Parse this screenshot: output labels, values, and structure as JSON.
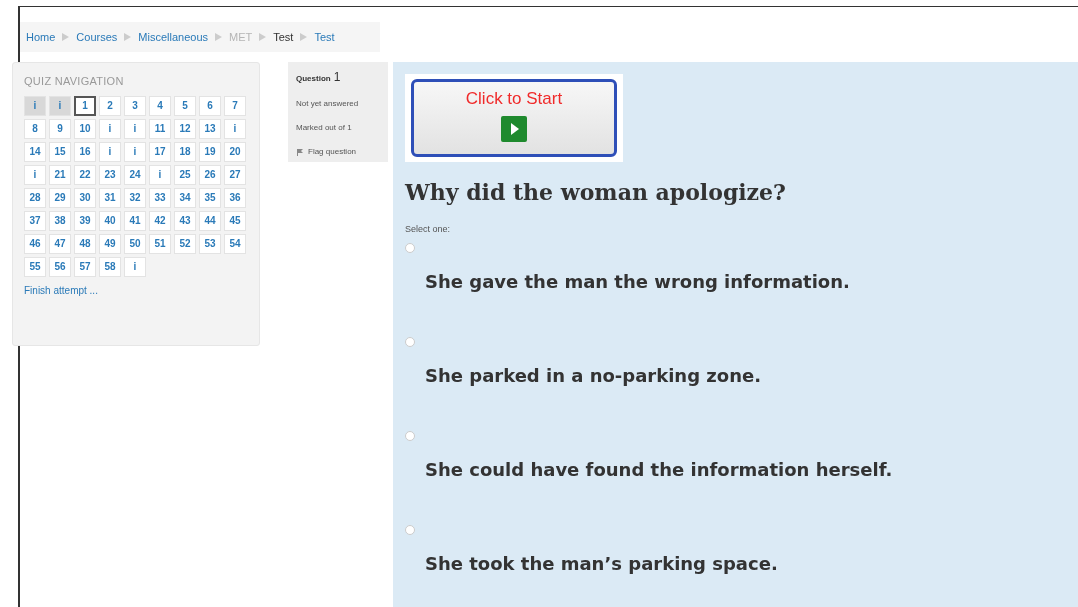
{
  "breadcrumb": [
    {
      "label": "Home",
      "kind": "link"
    },
    {
      "label": "Courses",
      "kind": "link"
    },
    {
      "label": "Miscellaneous",
      "kind": "link"
    },
    {
      "label": "MET",
      "kind": "muted"
    },
    {
      "label": "Test",
      "kind": "plain"
    },
    {
      "label": "Test",
      "kind": "link"
    }
  ],
  "quiz_navigation": {
    "title": "QUIZ NAVIGATION",
    "buttons": [
      {
        "label": "i",
        "selected": false,
        "shaded": true
      },
      {
        "label": "i",
        "selected": false,
        "shaded": true
      },
      {
        "label": "1",
        "selected": true,
        "shaded": false
      },
      {
        "label": "2",
        "selected": false,
        "shaded": false
      },
      {
        "label": "3",
        "selected": false,
        "shaded": false
      },
      {
        "label": "4",
        "selected": false,
        "shaded": false
      },
      {
        "label": "5",
        "selected": false,
        "shaded": false
      },
      {
        "label": "6",
        "selected": false,
        "shaded": false
      },
      {
        "label": "7",
        "selected": false,
        "shaded": false
      },
      {
        "label": "8",
        "selected": false,
        "shaded": false
      },
      {
        "label": "9",
        "selected": false,
        "shaded": false
      },
      {
        "label": "10",
        "selected": false,
        "shaded": false
      },
      {
        "label": "i",
        "selected": false,
        "shaded": false
      },
      {
        "label": "i",
        "selected": false,
        "shaded": false
      },
      {
        "label": "11",
        "selected": false,
        "shaded": false
      },
      {
        "label": "12",
        "selected": false,
        "shaded": false
      },
      {
        "label": "13",
        "selected": false,
        "shaded": false
      },
      {
        "label": "i",
        "selected": false,
        "shaded": false
      },
      {
        "label": "14",
        "selected": false,
        "shaded": false
      },
      {
        "label": "15",
        "selected": false,
        "shaded": false
      },
      {
        "label": "16",
        "selected": false,
        "shaded": false
      },
      {
        "label": "i",
        "selected": false,
        "shaded": false
      },
      {
        "label": "i",
        "selected": false,
        "shaded": false
      },
      {
        "label": "17",
        "selected": false,
        "shaded": false
      },
      {
        "label": "18",
        "selected": false,
        "shaded": false
      },
      {
        "label": "19",
        "selected": false,
        "shaded": false
      },
      {
        "label": "20",
        "selected": false,
        "shaded": false
      },
      {
        "label": "i",
        "selected": false,
        "shaded": false
      },
      {
        "label": "21",
        "selected": false,
        "shaded": false
      },
      {
        "label": "22",
        "selected": false,
        "shaded": false
      },
      {
        "label": "23",
        "selected": false,
        "shaded": false
      },
      {
        "label": "24",
        "selected": false,
        "shaded": false
      },
      {
        "label": "i",
        "selected": false,
        "shaded": false
      },
      {
        "label": "25",
        "selected": false,
        "shaded": false
      },
      {
        "label": "26",
        "selected": false,
        "shaded": false
      },
      {
        "label": "27",
        "selected": false,
        "shaded": false
      },
      {
        "label": "28",
        "selected": false,
        "shaded": false
      },
      {
        "label": "29",
        "selected": false,
        "shaded": false
      },
      {
        "label": "30",
        "selected": false,
        "shaded": false
      },
      {
        "label": "31",
        "selected": false,
        "shaded": false
      },
      {
        "label": "32",
        "selected": false,
        "shaded": false
      },
      {
        "label": "33",
        "selected": false,
        "shaded": false
      },
      {
        "label": "34",
        "selected": false,
        "shaded": false
      },
      {
        "label": "35",
        "selected": false,
        "shaded": false
      },
      {
        "label": "36",
        "selected": false,
        "shaded": false
      },
      {
        "label": "37",
        "selected": false,
        "shaded": false
      },
      {
        "label": "38",
        "selected": false,
        "shaded": false
      },
      {
        "label": "39",
        "selected": false,
        "shaded": false
      },
      {
        "label": "40",
        "selected": false,
        "shaded": false
      },
      {
        "label": "41",
        "selected": false,
        "shaded": false
      },
      {
        "label": "42",
        "selected": false,
        "shaded": false
      },
      {
        "label": "43",
        "selected": false,
        "shaded": false
      },
      {
        "label": "44",
        "selected": false,
        "shaded": false
      },
      {
        "label": "45",
        "selected": false,
        "shaded": false
      },
      {
        "label": "46",
        "selected": false,
        "shaded": false
      },
      {
        "label": "47",
        "selected": false,
        "shaded": false
      },
      {
        "label": "48",
        "selected": false,
        "shaded": false
      },
      {
        "label": "49",
        "selected": false,
        "shaded": false
      },
      {
        "label": "50",
        "selected": false,
        "shaded": false
      },
      {
        "label": "51",
        "selected": false,
        "shaded": false
      },
      {
        "label": "52",
        "selected": false,
        "shaded": false
      },
      {
        "label": "53",
        "selected": false,
        "shaded": false
      },
      {
        "label": "54",
        "selected": false,
        "shaded": false
      },
      {
        "label": "55",
        "selected": false,
        "shaded": false
      },
      {
        "label": "56",
        "selected": false,
        "shaded": false
      },
      {
        "label": "57",
        "selected": false,
        "shaded": false
      },
      {
        "label": "58",
        "selected": false,
        "shaded": false
      },
      {
        "label": "i",
        "selected": false,
        "shaded": false
      }
    ],
    "finish_link": "Finish attempt ..."
  },
  "question_info": {
    "label": "Question",
    "number": "1",
    "status": "Not yet answered",
    "marks": "Marked out of 1",
    "flag": "Flag question"
  },
  "question": {
    "start_button": "Click to Start",
    "text": "Why did the woman apologize?",
    "prompt": "Select one:",
    "options": [
      {
        "label": "She gave the man the wrong information.",
        "selected": false
      },
      {
        "label": "She parked in a no-parking zone.",
        "selected": false
      },
      {
        "label": "She could have found the information herself.",
        "selected": false
      },
      {
        "label": "She took the man’s parking space.",
        "selected": false
      }
    ]
  }
}
